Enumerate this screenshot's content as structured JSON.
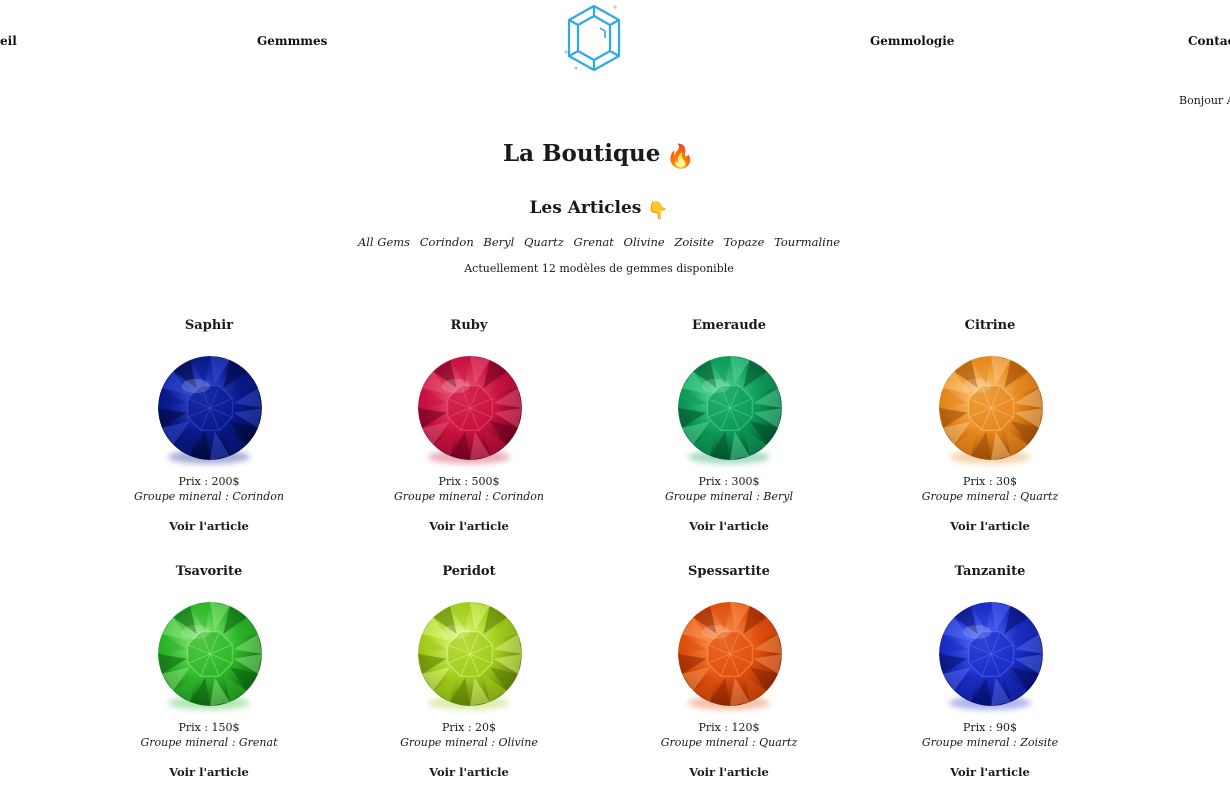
{
  "nav": {
    "left_partial": "eil",
    "gemmes": "Gemmmes",
    "gemmologie": "Gemmologie",
    "contact": "Contact",
    "greeting": "Bonjour A"
  },
  "page": {
    "title": "La Boutique",
    "title_emoji": "🔥",
    "subtitle": "Les Articles",
    "subtitle_emoji": "👇",
    "count_text": "Actuellement 12 modèles de gemmes disponible"
  },
  "filters": [
    "All Gems",
    "Corindon",
    "Beryl",
    "Quartz",
    "Grenat",
    "Olivine",
    "Zoisite",
    "Topaze",
    "Tourmaline"
  ],
  "gems": [
    {
      "name": "Saphir",
      "price": "Prix : 200$",
      "group": "Groupe mineral : Corindon",
      "link": "Voir l'article",
      "color": "#0a1a8c",
      "light": "#3a55e0",
      "dark": "#020a3a"
    },
    {
      "name": "Ruby",
      "price": "Prix : 500$",
      "group": "Groupe mineral : Corindon",
      "link": "Voir l'article",
      "color": "#c8123f",
      "light": "#f06080",
      "dark": "#6a0020"
    },
    {
      "name": "Emeraude",
      "price": "Prix : 300$",
      "group": "Groupe mineral : Beryl",
      "link": "Voir l'article",
      "color": "#0e9a5a",
      "light": "#5fe0a0",
      "dark": "#03502c"
    },
    {
      "name": "Citrine",
      "price": "Prix : 30$",
      "group": "Groupe mineral : Quartz",
      "link": "Voir l'article",
      "color": "#e6881e",
      "light": "#ffd08a",
      "dark": "#9a4a08"
    },
    {
      "name": "Tsavorite",
      "price": "Prix : 150$",
      "group": "Groupe mineral : Grenat",
      "link": "Voir l'article",
      "color": "#2eb62a",
      "light": "#9af08a",
      "dark": "#0c6010"
    },
    {
      "name": "Peridot",
      "price": "Prix : 20$",
      "group": "Groupe mineral : Olivine",
      "link": "Voir l'article",
      "color": "#a2cc1e",
      "light": "#eaff8a",
      "dark": "#5a7a06"
    },
    {
      "name": "Spessartite",
      "price": "Prix : 120$",
      "group": "Groupe mineral : Quartz",
      "link": "Voir l'article",
      "color": "#e0500e",
      "light": "#ffa060",
      "dark": "#8a2402"
    },
    {
      "name": "Tanzanite",
      "price": "Prix : 90$",
      "group": "Groupe mineral : Zoisite",
      "link": "Voir l'article",
      "color": "#1a2ec4",
      "light": "#5a74ff",
      "dark": "#060e6a"
    }
  ]
}
